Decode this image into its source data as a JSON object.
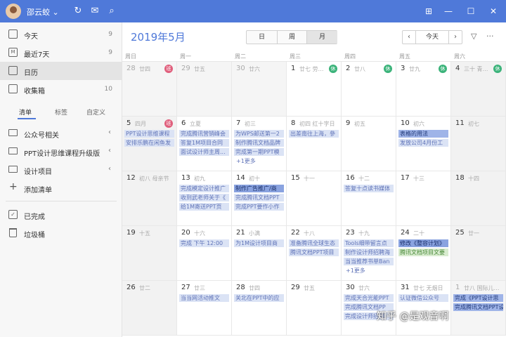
{
  "titlebar": {
    "username": "邵云蛟",
    "window_controls": {
      "pin": "⊞",
      "minimize": "—",
      "maximize": "☐",
      "close": "✕"
    }
  },
  "sidebar": {
    "smart_lists": [
      {
        "label": "今天",
        "count": "9",
        "icon": "calendar-day-icon"
      },
      {
        "label": "最近7天",
        "count": "9",
        "icon": "calendar-week-icon"
      },
      {
        "label": "日历",
        "count": "",
        "icon": "calendar-icon"
      },
      {
        "label": "收集箱",
        "count": "10",
        "icon": "inbox-icon"
      }
    ],
    "tabs": [
      "清单",
      "标签",
      "自定义"
    ],
    "lists": [
      {
        "label": "公众号相关"
      },
      {
        "label": "PPT设计思维课程升级版"
      },
      {
        "label": "设计项目"
      }
    ],
    "add_list": "添加清单",
    "bottom": [
      {
        "label": "已完成"
      },
      {
        "label": "垃圾桶"
      }
    ]
  },
  "header": {
    "month_title": "2019年5月",
    "views": [
      "日",
      "周",
      "月"
    ],
    "active_view": "月",
    "today": "今天"
  },
  "weekdays": [
    "周日",
    "周一",
    "周二",
    "周三",
    "周四",
    "周五",
    "周六"
  ],
  "weeks": [
    [
      {
        "day": "28",
        "lunar": "廿四",
        "badge": "班",
        "other": true,
        "events": []
      },
      {
        "day": "29",
        "lunar": "廿五",
        "other": true,
        "events": []
      },
      {
        "day": "30",
        "lunar": "廿六",
        "other": true,
        "events": []
      },
      {
        "day": "1",
        "lunar": "廿七 劳…",
        "badge": "休",
        "events": []
      },
      {
        "day": "2",
        "lunar": "廿八",
        "badge": "休",
        "events": []
      },
      {
        "day": "3",
        "lunar": "廿九",
        "badge": "休",
        "events": []
      },
      {
        "day": "4",
        "lunar": "三十 青…",
        "badge": "休",
        "events": []
      }
    ],
    [
      {
        "day": "5",
        "lunar": "四月",
        "badge": "班",
        "events": [
          {
            "t": "PPT设计思维课程"
          },
          {
            "t": "安排乐鹏在闲鱼发"
          }
        ]
      },
      {
        "day": "6",
        "lunar": "立夏",
        "events": [
          {
            "t": "完成腾讯营销峰会"
          },
          {
            "t": "答复1M项目合同"
          },
          {
            "t": "面试设计师主周..."
          }
        ]
      },
      {
        "day": "7",
        "lunar": "初三",
        "events": [
          {
            "t": "为WPS邮送第一2"
          },
          {
            "t": "制作腾讯文档品牌"
          },
          {
            "t": "完成第一期PPT模"
          }
        ],
        "more": "+1更多"
      },
      {
        "day": "8",
        "lunar": "初四 红十字日",
        "events": [
          {
            "t": "出差南往上海，參"
          }
        ]
      },
      {
        "day": "9",
        "lunar": "初五",
        "events": []
      },
      {
        "day": "10",
        "lunar": "初六",
        "events": [
          {
            "t": "表格的用法",
            "style": "dark"
          },
          {
            "t": "发放公司4月份工"
          }
        ]
      },
      {
        "day": "11",
        "lunar": "初七",
        "events": []
      }
    ],
    [
      {
        "day": "12",
        "lunar": "初八 母亲节",
        "events": []
      },
      {
        "day": "13",
        "lunar": "初九",
        "events": [
          {
            "t": "完成模定设计推广"
          },
          {
            "t": "收到武老师关于《"
          },
          {
            "t": "给1M寄送PPT页"
          }
        ]
      },
      {
        "day": "14",
        "lunar": "初十",
        "events": [
          {
            "t": "制作广告推广/商",
            "style": "dark2"
          },
          {
            "t": "完成腾讯文档PPT"
          },
          {
            "t": "完成PPT要作小作"
          }
        ]
      },
      {
        "day": "15",
        "lunar": "十一",
        "events": []
      },
      {
        "day": "16",
        "lunar": "十二",
        "events": [
          {
            "t": "答复十点读书媒体"
          }
        ]
      },
      {
        "day": "17",
        "lunar": "十三",
        "events": []
      },
      {
        "day": "18",
        "lunar": "十四",
        "events": []
      }
    ],
    [
      {
        "day": "19",
        "lunar": "十五",
        "events": []
      },
      {
        "day": "20",
        "lunar": "十六",
        "events": [
          {
            "t": "完成 下午 12:00"
          }
        ]
      },
      {
        "day": "21",
        "lunar": "小满",
        "events": [
          {
            "t": "为1M设计项目商"
          }
        ]
      },
      {
        "day": "22",
        "lunar": "十八",
        "events": [
          {
            "t": "准备腾讯全球生态"
          },
          {
            "t": "腾讯文档PPT项目"
          }
        ]
      },
      {
        "day": "23",
        "lunar": "十九",
        "events": [
          {
            "t": "Tools细带留言点"
          },
          {
            "t": "制作设计师招聘海"
          },
          {
            "t": "当当推荐书单Ban"
          }
        ],
        "more": "+1更多"
      },
      {
        "day": "24",
        "lunar": "二十",
        "events": [
          {
            "t": "修改《整容计划》",
            "style": "dark2"
          },
          {
            "t": "腾讯文档项目文要",
            "style": "green"
          }
        ]
      },
      {
        "day": "25",
        "lunar": "廿一",
        "events": []
      }
    ],
    [
      {
        "day": "26",
        "lunar": "廿二",
        "events": []
      },
      {
        "day": "27",
        "lunar": "廿三",
        "events": [
          {
            "t": "当当网活动推文"
          }
        ]
      },
      {
        "day": "28",
        "lunar": "廿四",
        "events": [
          {
            "t": "关北在PPT中的应"
          }
        ]
      },
      {
        "day": "29",
        "lunar": "廿五",
        "events": []
      },
      {
        "day": "30",
        "lunar": "廿六",
        "events": [
          {
            "t": "完成天合光能PPT"
          },
          {
            "t": "完成腾讯文档PP"
          },
          {
            "t": "完成设计师招聘"
          }
        ]
      },
      {
        "day": "31",
        "lunar": "廿七 无烟日",
        "events": [
          {
            "t": "认证微信公众号"
          }
        ]
      },
      {
        "day": "1",
        "lunar": "廿八 国际儿…",
        "other": true,
        "events": [
          {
            "t": "完成《PPT设计思",
            "style": "dark"
          },
          {
            "t": "完成腾讯文档PPT设",
            "style": "dark"
          }
        ]
      }
    ]
  ],
  "watermark": "知乎 @是观音啊"
}
